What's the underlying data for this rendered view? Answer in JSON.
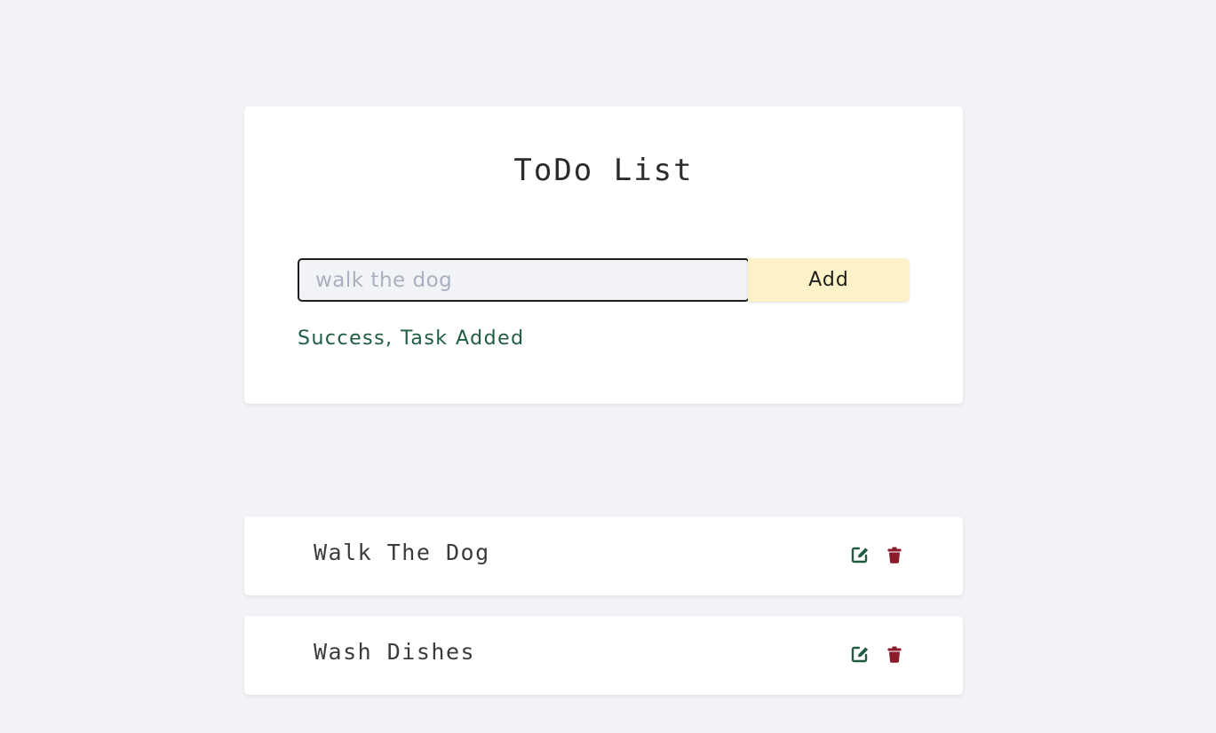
{
  "form": {
    "title": "ToDo List",
    "input_value": "",
    "input_placeholder": "walk the dog",
    "add_label": "Add",
    "alert_text": "Success, Task Added"
  },
  "tasks": [
    {
      "name": "Walk The Dog",
      "edit_icon": "edit-icon",
      "delete_icon": "trash-icon"
    },
    {
      "name": "Wash Dishes",
      "edit_icon": "edit-icon",
      "delete_icon": "trash-icon"
    }
  ],
  "colors": {
    "page_background": "#f1f3f7",
    "card_background": "#ffffff",
    "add_button": "#fdf1c7",
    "success_text": "#1f5c40",
    "edit_icon": "#1f5c40",
    "delete_icon": "#8b1a2b"
  }
}
